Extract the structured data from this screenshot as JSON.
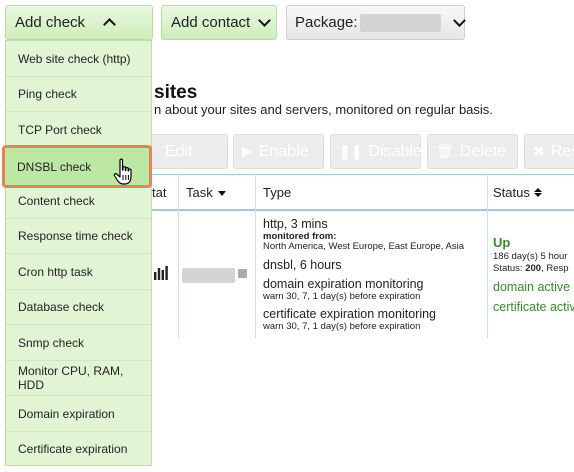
{
  "toolbar": {
    "add_check_label": "Add check",
    "add_contact_label": "Add contact",
    "package_label": "Package:"
  },
  "page": {
    "title": "sites",
    "subtitle": "n about your sites and servers, monitored on regular basis."
  },
  "actions": {
    "edit": "Edit",
    "enable": "Enable",
    "disable": "Disable",
    "delete": "Delete",
    "reset": "Res"
  },
  "table": {
    "headers": {
      "stat": "tat",
      "task": "Task",
      "type": "Type",
      "status": "Status"
    },
    "row": {
      "type_lines": {
        "http": "http, 3 mins",
        "monitored_from_label": "monitored from:",
        "regions": "North America, West Europe, East Europe, Asia",
        "dnsbl": "dnsbl, 6 hours",
        "domain_exp": "domain expiration monitoring",
        "domain_warn": "warn 30, 7, 1 day(s) before expiration",
        "cert_exp": "certificate expiration monitoring",
        "cert_warn": "warn 30, 7, 1 day(s) before expiration"
      },
      "status": {
        "state": "Up",
        "uptime": "186 day(s) 5 hour",
        "status_prefix": "Status:",
        "status_code": "200",
        "status_suffix": ", Resp",
        "domain_active": "domain active",
        "cert_active": "certificate activ"
      }
    }
  },
  "dropdown": {
    "items": [
      "Web site check (http)",
      "Ping check",
      "TCP Port check",
      "DNSBL check",
      "Content check",
      "Response time check",
      "Cron http task",
      "Database check",
      "Snmp check",
      "Monitor CPU, RAM, HDD",
      "Domain expiration",
      "Certificate expiration"
    ],
    "highlighted_index": 3
  },
  "colors": {
    "accent_green": "#e1f5d4",
    "highlight_border": "#e8805a",
    "status_green": "#3a8a2a"
  }
}
